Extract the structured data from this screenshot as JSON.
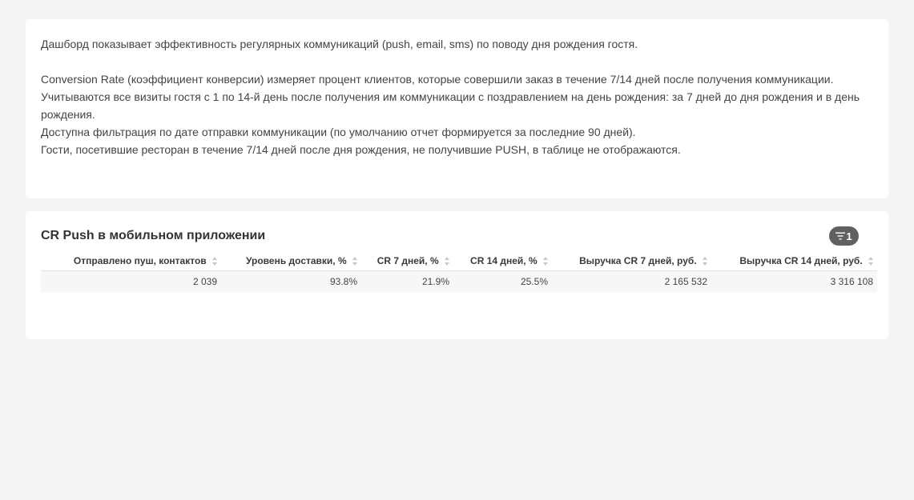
{
  "description": {
    "lines": [
      "Дашборд показывает эффективность регулярных коммуникаций (push, email, sms) по поводу дня рождения гостя.",
      "",
      "Conversion Rate (коэффициент конверсии) измеряет процент клиентов, которые совершили заказ в течение 7/14 дней после получения коммуникации.",
      "Учитываются все визиты гостя с 1 по 14-й день после получения им коммуникации с поздравлением на день рождения: за 7 дней до дня рождения и в день рождения.",
      "Доступна фильтрация по дате отправки коммуникации (по умолчанию отчет формируется за последние 90 дней).",
      "Гости, посетившие ресторан в течение 7/14 дней после дня рождения, не получившие PUSH, в таблице не отображаются."
    ]
  },
  "table_card": {
    "title": "CR Push в мобильном приложении",
    "filter_count": "1",
    "columns": [
      "Отправлено пуш, контактов",
      "Уровень доставки, %",
      "CR 7 дней, %",
      "CR 14 дней, %",
      "Выручка CR 7 дней, руб.",
      "Выручка CR 14 дней, руб."
    ],
    "rows": [
      [
        "2 039",
        "93.8%",
        "21.9%",
        "25.5%",
        "2 165 532",
        "3 316 108"
      ]
    ]
  },
  "colors": {
    "page_bg": "#f4f4f4",
    "card_bg": "#ffffff",
    "badge_bg": "#606060"
  }
}
